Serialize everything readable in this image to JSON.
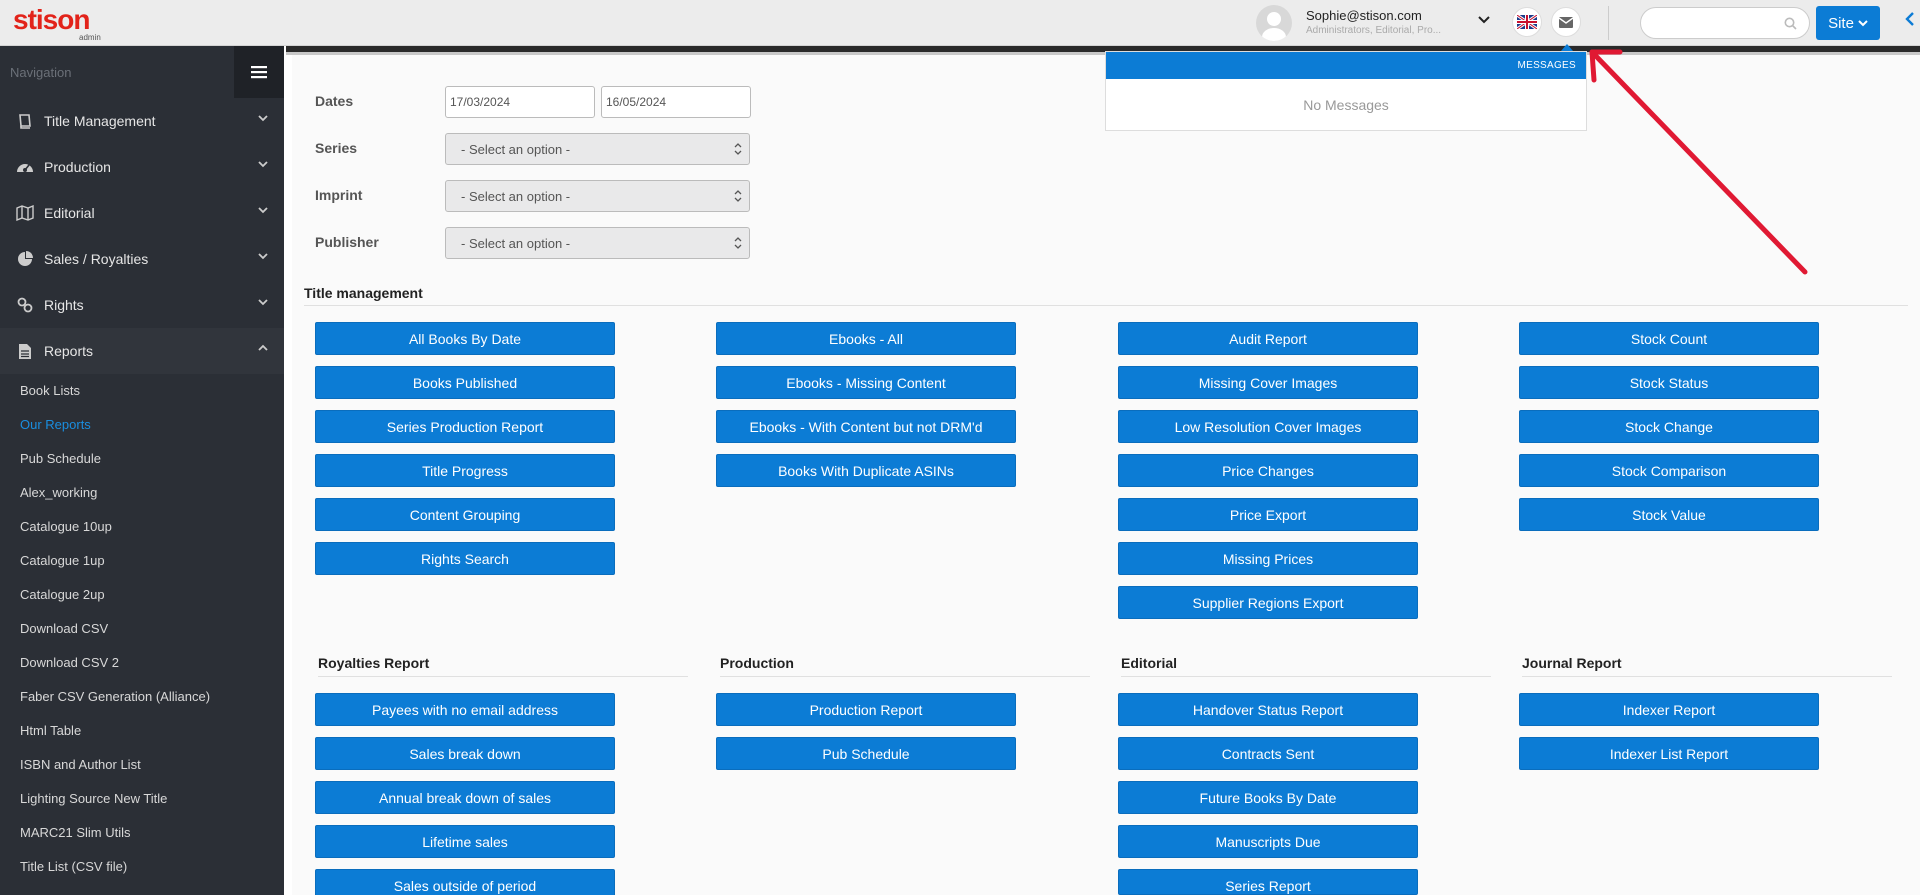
{
  "brand": {
    "name": "stison",
    "sub": "admin",
    "accent": "#e2231a"
  },
  "user": {
    "email": "Sophie@stison.com",
    "roles": "Administrators, Editorial, Pro..."
  },
  "header": {
    "site_label": "Site",
    "search_placeholder": ""
  },
  "colors": {
    "primary": "#0c7cd5",
    "sidebar": "#2b2f36",
    "active_link": "#1a8ee0"
  },
  "nav": {
    "title": "Navigation",
    "items": [
      {
        "label": "Title Management",
        "icon": "book-icon"
      },
      {
        "label": "Production",
        "icon": "dashboard-icon"
      },
      {
        "label": "Editorial",
        "icon": "map-icon"
      },
      {
        "label": "Sales / Royalties",
        "icon": "pie-chart-icon"
      },
      {
        "label": "Rights",
        "icon": "link-icon"
      },
      {
        "label": "Reports",
        "icon": "file-icon"
      }
    ],
    "sub_items": [
      "Book Lists",
      "Our Reports",
      "Pub Schedule",
      "Alex_working",
      "Catalogue 10up",
      "Catalogue 1up",
      "Catalogue 2up",
      "Download CSV",
      "Download CSV 2",
      "Faber CSV Generation (Alliance)",
      "Html Table",
      "ISBN and Author List",
      "Lighting Source New Title",
      "MARC21 Slim Utils",
      "Title List (CSV file)"
    ],
    "active_sub": "Our Reports"
  },
  "filters": {
    "dates_label": "Dates",
    "date_from": "17/03/2024",
    "date_to": "16/05/2024",
    "series_label": "Series",
    "imprint_label": "Imprint",
    "publisher_label": "Publisher",
    "select_placeholder": "- Select an option -"
  },
  "sections": {
    "title_management": {
      "title": "Title management",
      "col1": [
        "All Books By Date",
        "Books Published",
        "Series Production Report",
        "Title Progress",
        "Content Grouping",
        "Rights Search"
      ],
      "col2": [
        "Ebooks - All",
        "Ebooks - Missing Content",
        "Ebooks - With Content but not DRM'd",
        "Books With Duplicate ASINs"
      ],
      "col3": [
        "Audit Report",
        "Missing Cover Images",
        "Low Resolution Cover Images",
        "Price Changes",
        "Price Export",
        "Missing Prices",
        "Supplier Regions Export"
      ],
      "col4": [
        "Stock Count",
        "Stock Status",
        "Stock Change",
        "Stock Comparison",
        "Stock Value"
      ]
    },
    "royalties": {
      "title": "Royalties Report",
      "buttons": [
        "Payees with no email address",
        "Sales break down",
        "Annual break down of sales",
        "Lifetime sales",
        "Sales outside of period"
      ]
    },
    "production": {
      "title": "Production",
      "buttons": [
        "Production Report",
        "Pub Schedule"
      ]
    },
    "editorial": {
      "title": "Editorial",
      "buttons": [
        "Handover Status Report",
        "Contracts Sent",
        "Future Books By Date",
        "Manuscripts Due",
        "Series Report"
      ]
    },
    "journal": {
      "title": "Journal Report",
      "buttons": [
        "Indexer Report",
        "Indexer List Report"
      ]
    }
  },
  "messages": {
    "header": "MESSAGES",
    "empty": "No Messages"
  }
}
